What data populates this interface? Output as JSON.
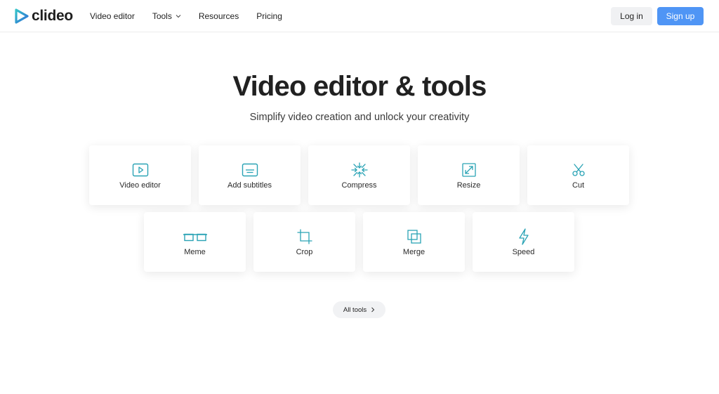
{
  "header": {
    "logo_text": "clideo",
    "nav": [
      {
        "label": "Video editor"
      },
      {
        "label": "Tools",
        "has_dropdown": true
      },
      {
        "label": "Resources"
      },
      {
        "label": "Pricing"
      }
    ],
    "login_label": "Log in",
    "signup_label": "Sign up"
  },
  "hero": {
    "title": "Video editor & tools",
    "subtitle": "Simplify video creation and unlock your creativity"
  },
  "tools": [
    {
      "label": "Video editor",
      "icon": "play-icon"
    },
    {
      "label": "Add subtitles",
      "icon": "subtitles-icon"
    },
    {
      "label": "Compress",
      "icon": "compress-icon"
    },
    {
      "label": "Resize",
      "icon": "resize-icon"
    },
    {
      "label": "Cut",
      "icon": "scissors-icon"
    },
    {
      "label": "Meme",
      "icon": "glasses-icon"
    },
    {
      "label": "Crop",
      "icon": "crop-icon"
    },
    {
      "label": "Merge",
      "icon": "merge-icon"
    },
    {
      "label": "Speed",
      "icon": "lightning-icon"
    }
  ],
  "all_tools_label": "All tools",
  "colors": {
    "accent": "#4f95f5",
    "icon": "#2aa3b5",
    "logo_teal": "#34c3c8",
    "logo_blue": "#2f6ed8"
  }
}
